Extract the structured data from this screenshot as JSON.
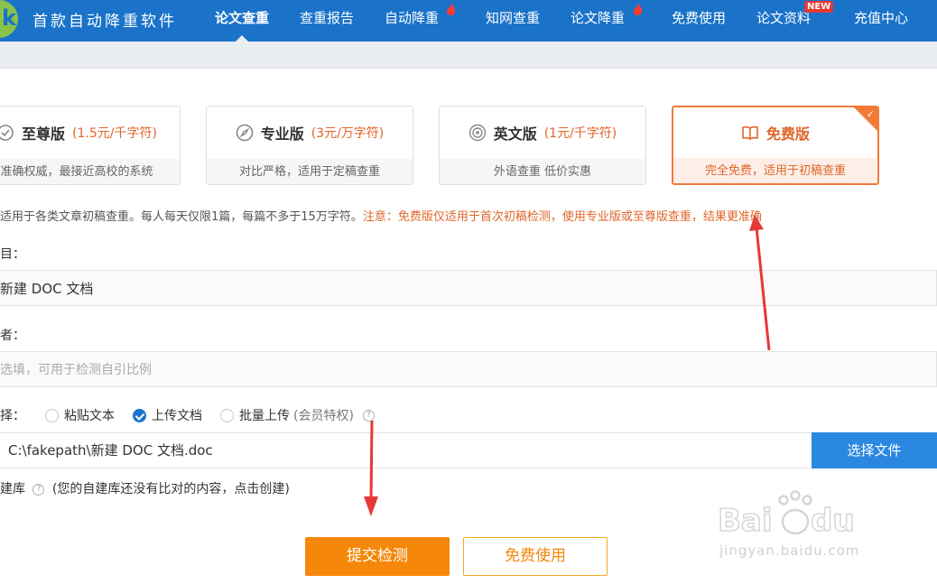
{
  "brand": {
    "logo_letter": "k",
    "name": "首款自动降重软件"
  },
  "nav": {
    "items": [
      {
        "label": "论文查重",
        "active": true
      },
      {
        "label": "查重报告"
      },
      {
        "label": "自动降重",
        "hot": true
      },
      {
        "label": "知网查重"
      },
      {
        "label": "论文降重",
        "hot": true
      },
      {
        "label": "免费使用"
      },
      {
        "label": "论文资料",
        "badge": "NEW"
      },
      {
        "label": "充值中心"
      }
    ]
  },
  "versions": [
    {
      "title": "至尊版",
      "price": "(1.5元/千字符)",
      "desc": "准确权威，最接近高校的系统",
      "icon": "shield-check-icon"
    },
    {
      "title": "专业版",
      "price": "(3元/万字符)",
      "desc": "对比严格，适用于定稿查重",
      "icon": "compass-icon"
    },
    {
      "title": "英文版",
      "price": "(1元/千字符)",
      "desc": "外语查重 低价实惠",
      "icon": "target-icon"
    },
    {
      "title": "免费版",
      "price": "",
      "desc": "完全免费，适用于初稿查重",
      "icon": "open-book-icon",
      "selected": true
    }
  ],
  "notice": {
    "text": "适用于各类文章初稿查重。每人每天仅限1篇，每篇不多于15万字符。",
    "warning": "注意：免费版仅适用于首次初稿检测，使用专业版或至尊版查重，结果更准确"
  },
  "form": {
    "title_label": "目：",
    "title_value": "新建 DOC 文档",
    "author_label": "者：",
    "author_placeholder": "选填，可用于检测自引比例",
    "mode_label": "择：",
    "modes": [
      {
        "label": "粘贴文本",
        "checked": false
      },
      {
        "label": "上传文档",
        "checked": true
      },
      {
        "label": "批量上传",
        "checked": false,
        "extra": "(会员特权)"
      }
    ],
    "file_path": "C:\\fakepath\\新建 DOC 文档.doc",
    "choose_file_label": "选择文件",
    "selfdb_label": "建库",
    "selfdb_hint": "(您的自建库还没有比对的内容，点击创建)"
  },
  "actions": {
    "submit_label": "提交检测",
    "free_label": "免费使用"
  },
  "watermark": {
    "text": "jingyan.baidu.com"
  },
  "colors": {
    "nav": "#1a73c9",
    "accent": "#f07a36",
    "submit": "#f5870a",
    "button_blue": "#2b88e0",
    "arrow": "#e53935"
  }
}
